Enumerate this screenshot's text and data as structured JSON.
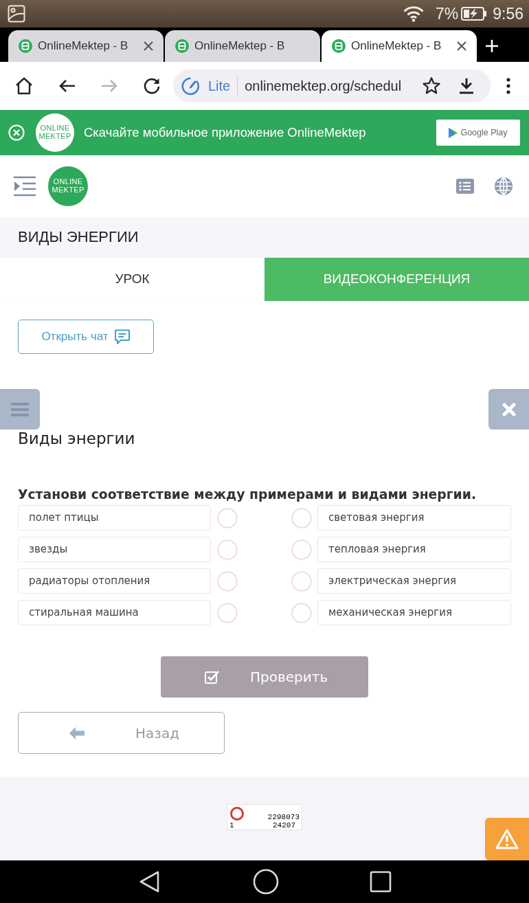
{
  "status_bar": {
    "battery": "7%",
    "time": "9:56"
  },
  "browser": {
    "tabs": [
      {
        "title": "OnlineMektep - В",
        "selected": false,
        "close_visible": true
      },
      {
        "title": "OnlineMektep - В",
        "selected": false,
        "close_visible": false
      },
      {
        "title": "OnlineMektep - В",
        "selected": true,
        "close_visible": true
      }
    ],
    "badge": "Lite",
    "url": "onlinemektep.org/schedul",
    "forward_disabled": true
  },
  "app_banner": {
    "logo": [
      "ONLINE",
      "MEKTEP"
    ],
    "text": "Скачайте мобильное приложение OnlineMektep",
    "store_button": "Google Play"
  },
  "header": {
    "logo": [
      "ONLINE",
      "MEKTEP"
    ]
  },
  "page_title": "ВИДЫ ЭНЕРГИИ",
  "lesson_tabs": [
    {
      "label": "УРОК",
      "selected": true
    },
    {
      "label": "ВИДЕОКОНФЕРЕНЦИЯ",
      "selected": false
    }
  ],
  "chat_button": "Открыть чат",
  "exercise": {
    "title": "Виды энергии",
    "instruction": "Установи соответствие между примерами и видами энергии.",
    "examples": [
      "полет птицы",
      "звезды",
      "радиаторы отопления",
      "стиральная машина"
    ],
    "energy_types": [
      "световая энергия",
      "тепловая энергия",
      "электрическая энергия",
      "механическая энергия"
    ],
    "check_button": {
      "label": "Проверить",
      "disabled": true
    },
    "back_button": "Назад"
  },
  "counter": [
    "2298073",
    "1",
    "24207"
  ]
}
